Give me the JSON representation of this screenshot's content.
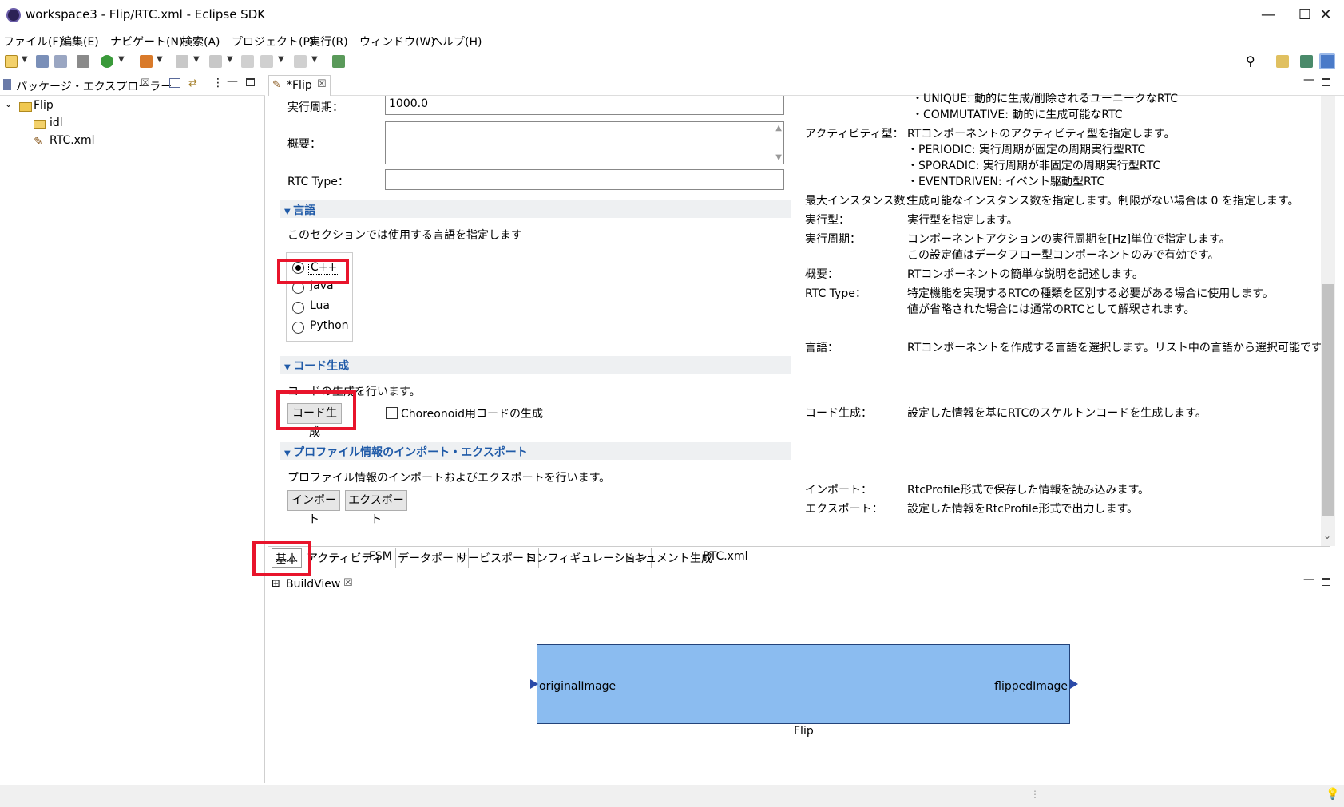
{
  "window": {
    "title": "workspace3 - Flip/RTC.xml - Eclipse SDK",
    "minimize": "—",
    "maximize": "☐",
    "close": "✕"
  },
  "menu": [
    "ファイル(F)",
    "編集(E)",
    "ナビゲート(N)",
    "検索(A)",
    "プロジェクト(P)",
    "実行(R)",
    "ウィンドウ(W)",
    "ヘルプ(H)"
  ],
  "left_panel": {
    "tab_label": "パッケージ・エクスプローラー",
    "tree": {
      "project": "Flip",
      "folder": "idl",
      "file": "RTC.xml"
    }
  },
  "editor": {
    "tab_label": "*Flip",
    "fields": {
      "period_label": "実行周期：",
      "period_value": "1000.0",
      "overview_label": "概要：",
      "rtc_type_label": "RTC Type："
    },
    "language_section": {
      "title": "言語",
      "description": "このセクションでは使用する言語を指定します",
      "options": [
        "C++",
        "Java",
        "Lua",
        "Python"
      ],
      "selected": "C++"
    },
    "codegen_section": {
      "title": "コード生成",
      "description": "コードの生成を行います。",
      "button": "コード生成",
      "checkbox_label": "Choreonoid用コードの生成"
    },
    "profile_section": {
      "title": "プロファイル情報のインポート・エクスポート",
      "description": "プロファイル情報のインポートおよびエクスポートを行います。",
      "import_button": "インポート",
      "export_button": "エクスポート"
    },
    "help": {
      "top_line1": "・UNIQUE: 動的に生成/削除されるユーニークなRTC",
      "top_line2": "・COMMUTATIVE: 動的に生成可能なRTC",
      "activity_label": "アクティビティ型：",
      "activity_lines": [
        "RTコンポーネントのアクティビティ型を指定します。",
        "・PERIODIC: 実行周期が固定の周期実行型RTC",
        "・SPORADIC: 実行周期が非固定の周期実行型RTC",
        "・EVENTDRIVEN: イベント駆動型RTC"
      ],
      "max_instance_label": "最大インスタンス数：",
      "max_instance_text": "生成可能なインスタンス数を指定します。制限がない場合は 0 を指定します。",
      "exec_type_label": "実行型：",
      "exec_type_text": "実行型を指定します。",
      "exec_period_label": "実行周期：",
      "exec_period_lines": [
        "コンポーネントアクションの実行周期を[Hz]単位で指定します。",
        "この設定値はデータフロー型コンポーネントのみで有効です。"
      ],
      "overview_label": "概要：",
      "overview_text": "RTコンポーネントの簡単な説明を記述します。",
      "rtc_type_label": "RTC Type：",
      "rtc_type_lines": [
        "特定機能を実現するRTCの種類を区別する必要がある場合に使用します。",
        "値が省略された場合には通常のRTCとして解釈されます。"
      ],
      "language_label": "言語：",
      "language_text": "RTコンポーネントを作成する言語を選択します。リスト中の言語から選択可能です。",
      "codegen_label": "コード生成：",
      "codegen_text": "設定した情報を基にRTCのスケルトンコードを生成します。",
      "import_label": "インポート：",
      "import_text": "RtcProfile形式で保存した情報を読み込みます。",
      "export_label": "エクスポート：",
      "export_text": "設定した情報をRtcProfile形式で出力します。"
    },
    "page_tabs": [
      "基本",
      "アクティビティ",
      "FSM",
      "データポート",
      "サービスポート",
      "コンフィギュレーション",
      "ドキュメント生成",
      "RTC.xml"
    ]
  },
  "build_view": {
    "tab_label": "BuildView",
    "component_name": "Flip",
    "in_port": "originalImage",
    "out_port": "flippedImage"
  },
  "colors": {
    "highlight": "#e8142b",
    "component_fill": "#8bbcf0",
    "section_title": "#1f5aa8"
  }
}
